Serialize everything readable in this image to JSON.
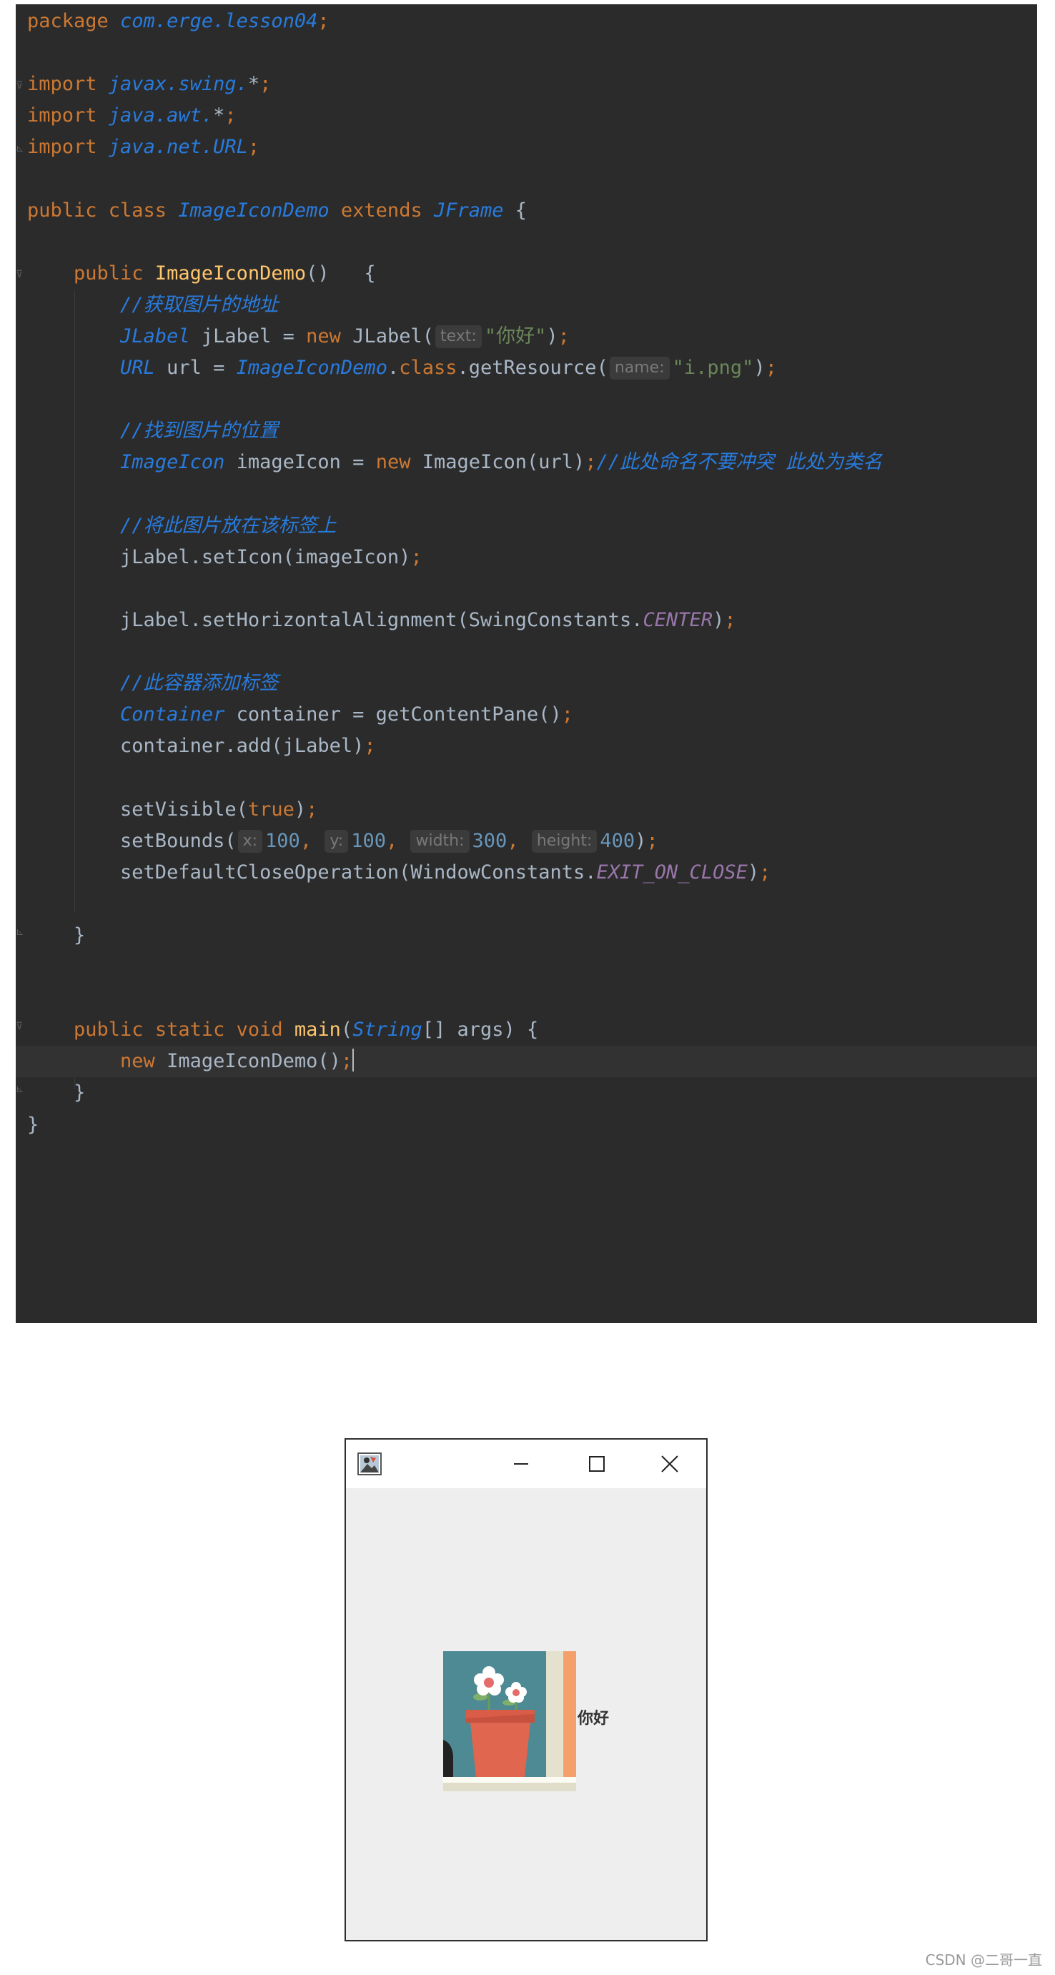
{
  "editor": {
    "lines": [
      [
        {
          "c": "kw",
          "t": "package "
        },
        {
          "c": "pkg",
          "t": "com.erge.lesson04"
        },
        {
          "c": "kw",
          "t": ";"
        }
      ],
      [],
      [
        {
          "c": "kw",
          "t": "import "
        },
        {
          "c": "pkg",
          "t": "javax.swing."
        },
        {
          "c": "txt",
          "t": "*"
        },
        {
          "c": "kw",
          "t": ";"
        }
      ],
      [
        {
          "c": "kw",
          "t": "import "
        },
        {
          "c": "pkg",
          "t": "java.awt."
        },
        {
          "c": "txt",
          "t": "*"
        },
        {
          "c": "kw",
          "t": ";"
        }
      ],
      [
        {
          "c": "kw",
          "t": "import "
        },
        {
          "c": "pkg",
          "t": "java.net.URL"
        },
        {
          "c": "kw",
          "t": ";"
        }
      ],
      [],
      [
        {
          "c": "kw",
          "t": "public class "
        },
        {
          "c": "cls",
          "t": "ImageIconDemo"
        },
        {
          "c": "kw",
          "t": " extends "
        },
        {
          "c": "cls",
          "t": "JFrame"
        },
        {
          "c": "txt",
          "t": " {"
        }
      ],
      [],
      [
        {
          "c": "txt",
          "t": "    "
        },
        {
          "c": "kw",
          "t": "public "
        },
        {
          "c": "fn",
          "t": "ImageIconDemo"
        },
        {
          "c": "txt",
          "t": "()   {"
        }
      ],
      [
        {
          "c": "txt",
          "t": "        "
        },
        {
          "c": "cmt",
          "t": "//获取图片的地址"
        }
      ],
      [
        {
          "c": "txt",
          "t": "        "
        },
        {
          "c": "cls",
          "t": "JLabel"
        },
        {
          "c": "txt",
          "t": " jLabel = "
        },
        {
          "c": "kw",
          "t": "new "
        },
        {
          "c": "txt",
          "t": "JLabel("
        },
        {
          "c": "hint",
          "t": "text:"
        },
        {
          "c": "str",
          "t": "\"你好\""
        },
        {
          "c": "txt",
          "t": ")"
        },
        {
          "c": "kw",
          "t": ";"
        }
      ],
      [
        {
          "c": "txt",
          "t": "        "
        },
        {
          "c": "cls",
          "t": "URL"
        },
        {
          "c": "txt",
          "t": " url = "
        },
        {
          "c": "cls",
          "t": "ImageIconDemo"
        },
        {
          "c": "txt",
          "t": "."
        },
        {
          "c": "kw",
          "t": "class"
        },
        {
          "c": "txt",
          "t": ".getResource("
        },
        {
          "c": "hint",
          "t": "name:"
        },
        {
          "c": "str",
          "t": "\"i.png\""
        },
        {
          "c": "txt",
          "t": ")"
        },
        {
          "c": "kw",
          "t": ";"
        }
      ],
      [],
      [
        {
          "c": "txt",
          "t": "        "
        },
        {
          "c": "cmt",
          "t": "//找到图片的位置"
        }
      ],
      [
        {
          "c": "txt",
          "t": "        "
        },
        {
          "c": "cls",
          "t": "ImageIcon"
        },
        {
          "c": "txt",
          "t": " imageIcon = "
        },
        {
          "c": "kw",
          "t": "new "
        },
        {
          "c": "txt",
          "t": "ImageIcon(url)"
        },
        {
          "c": "kw",
          "t": ";"
        },
        {
          "c": "cmt",
          "t": "//此处命名不要冲突 此处为类名"
        }
      ],
      [],
      [
        {
          "c": "txt",
          "t": "        "
        },
        {
          "c": "cmt",
          "t": "//将此图片放在该标签上"
        }
      ],
      [
        {
          "c": "txt",
          "t": "        jLabel.setIcon(imageIcon)"
        },
        {
          "c": "kw",
          "t": ";"
        }
      ],
      [],
      [
        {
          "c": "txt",
          "t": "        jLabel.setHorizontalAlignment(SwingConstants."
        },
        {
          "c": "cst",
          "t": "CENTER"
        },
        {
          "c": "txt",
          "t": ")"
        },
        {
          "c": "kw",
          "t": ";"
        }
      ],
      [],
      [
        {
          "c": "txt",
          "t": "        "
        },
        {
          "c": "cmt",
          "t": "//此容器添加标签"
        }
      ],
      [
        {
          "c": "txt",
          "t": "        "
        },
        {
          "c": "cls",
          "t": "Container"
        },
        {
          "c": "txt",
          "t": " container = getContentPane()"
        },
        {
          "c": "kw",
          "t": ";"
        }
      ],
      [
        {
          "c": "txt",
          "t": "        container.add(jLabel)"
        },
        {
          "c": "kw",
          "t": ";"
        }
      ],
      [],
      [
        {
          "c": "txt",
          "t": "        setVisible("
        },
        {
          "c": "kw",
          "t": "true"
        },
        {
          "c": "txt",
          "t": ")"
        },
        {
          "c": "kw",
          "t": ";"
        }
      ],
      [
        {
          "c": "txt",
          "t": "        setBounds("
        },
        {
          "c": "hint",
          "t": "x:"
        },
        {
          "c": "num",
          "t": "100"
        },
        {
          "c": "kw",
          "t": ", "
        },
        {
          "c": "hint",
          "t": "y:"
        },
        {
          "c": "num",
          "t": "100"
        },
        {
          "c": "kw",
          "t": ", "
        },
        {
          "c": "hint",
          "t": "width:"
        },
        {
          "c": "num",
          "t": "300"
        },
        {
          "c": "kw",
          "t": ", "
        },
        {
          "c": "hint",
          "t": "height:"
        },
        {
          "c": "num",
          "t": "400"
        },
        {
          "c": "txt",
          "t": ")"
        },
        {
          "c": "kw",
          "t": ";"
        }
      ],
      [
        {
          "c": "txt",
          "t": "        setDefaultCloseOperation(WindowConstants."
        },
        {
          "c": "cst",
          "t": "EXIT_ON_CLOSE"
        },
        {
          "c": "txt",
          "t": ")"
        },
        {
          "c": "kw",
          "t": ";"
        }
      ],
      [],
      [
        {
          "c": "txt",
          "t": "    }"
        }
      ],
      [],
      [],
      [
        {
          "c": "txt",
          "t": "    "
        },
        {
          "c": "kw",
          "t": "public static void "
        },
        {
          "c": "fn",
          "t": "main"
        },
        {
          "c": "txt",
          "t": "("
        },
        {
          "c": "cls",
          "t": "String"
        },
        {
          "c": "txt",
          "t": "[] args) {"
        }
      ],
      [
        {
          "c": "txt",
          "t": "        "
        },
        {
          "c": "kw",
          "t": "new "
        },
        {
          "c": "txt",
          "t": "ImageIconDemo()"
        },
        {
          "c": "kw",
          "t": ";"
        },
        {
          "c": "caret",
          "t": ""
        }
      ],
      [
        {
          "c": "txt",
          "t": "    }"
        }
      ],
      [
        {
          "c": "txt",
          "t": "}"
        }
      ]
    ],
    "current_line_index": 33
  },
  "window": {
    "title": "",
    "minimize_icon": "minimize-icon",
    "maximize_icon": "maximize-icon",
    "close_icon": "close-icon",
    "label_text": "你好",
    "icon_name": "flower-pot-image"
  },
  "watermark": "CSDN @二哥一直"
}
